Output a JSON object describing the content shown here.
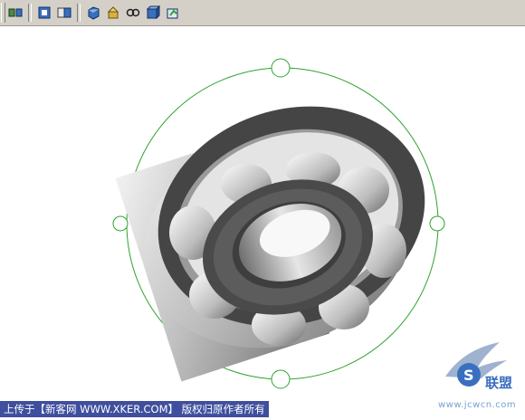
{
  "toolbar": {
    "buttons": [
      {
        "icon": "view-orient-icon",
        "label": ""
      },
      {
        "icon": "view-front-icon",
        "label": ""
      },
      {
        "icon": "view-section-icon",
        "label": ""
      },
      {
        "icon": "shaded-view-icon",
        "label": ""
      },
      {
        "icon": "component-icon",
        "label": ""
      },
      {
        "icon": "link-icon",
        "label": ""
      },
      {
        "icon": "cube-view-icon",
        "label": ""
      },
      {
        "icon": "rotate-icon",
        "label": ""
      }
    ]
  },
  "caption": {
    "text": "上传于【新客网 WWW.XKER.COM】 版权归原作者所有"
  },
  "watermark": {
    "logo_text": "联盟",
    "url_text": "www.jcwcn.com",
    "colors": {
      "wing": "#8ea6c8",
      "accent": "#3a6fc0"
    }
  },
  "colors": {
    "toolbar_bg": "#d4d0c8",
    "handle_green": "#2ea32e",
    "caption_bg": "#3f4f9e"
  }
}
